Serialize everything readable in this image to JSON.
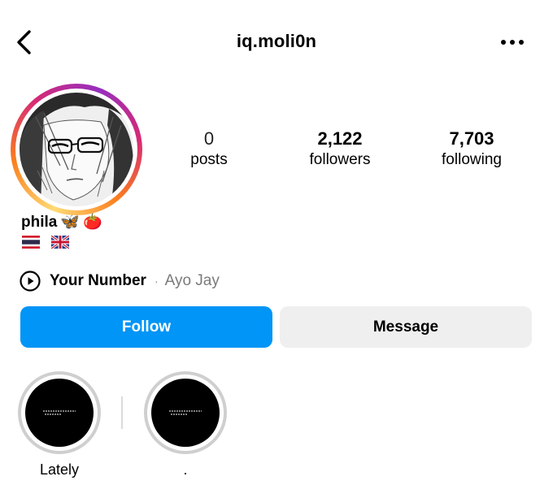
{
  "header": {
    "username": "iq.moli0n"
  },
  "profile": {
    "name": "phila",
    "name_emojis": [
      "🦋",
      "🍅"
    ],
    "flags": [
      "Thailand",
      "United Kingdom"
    ]
  },
  "stats": {
    "posts": {
      "value": "0",
      "label": "posts"
    },
    "followers": {
      "value": "2,122",
      "label": "followers"
    },
    "following": {
      "value": "7,703",
      "label": "following"
    }
  },
  "music": {
    "song": "Your Number",
    "separator": "·",
    "artist": "Ayo Jay"
  },
  "actions": {
    "follow_label": "Follow",
    "message_label": "Message"
  },
  "highlights": [
    {
      "title": "Lately"
    },
    {
      "title": "."
    }
  ],
  "colors": {
    "follow_blue": "#0095f6",
    "message_gray": "#efefef",
    "secondary_text": "#7a7a7a"
  },
  "icons": [
    "back-chevron-icon",
    "more-options-icon",
    "play-circle-icon"
  ]
}
